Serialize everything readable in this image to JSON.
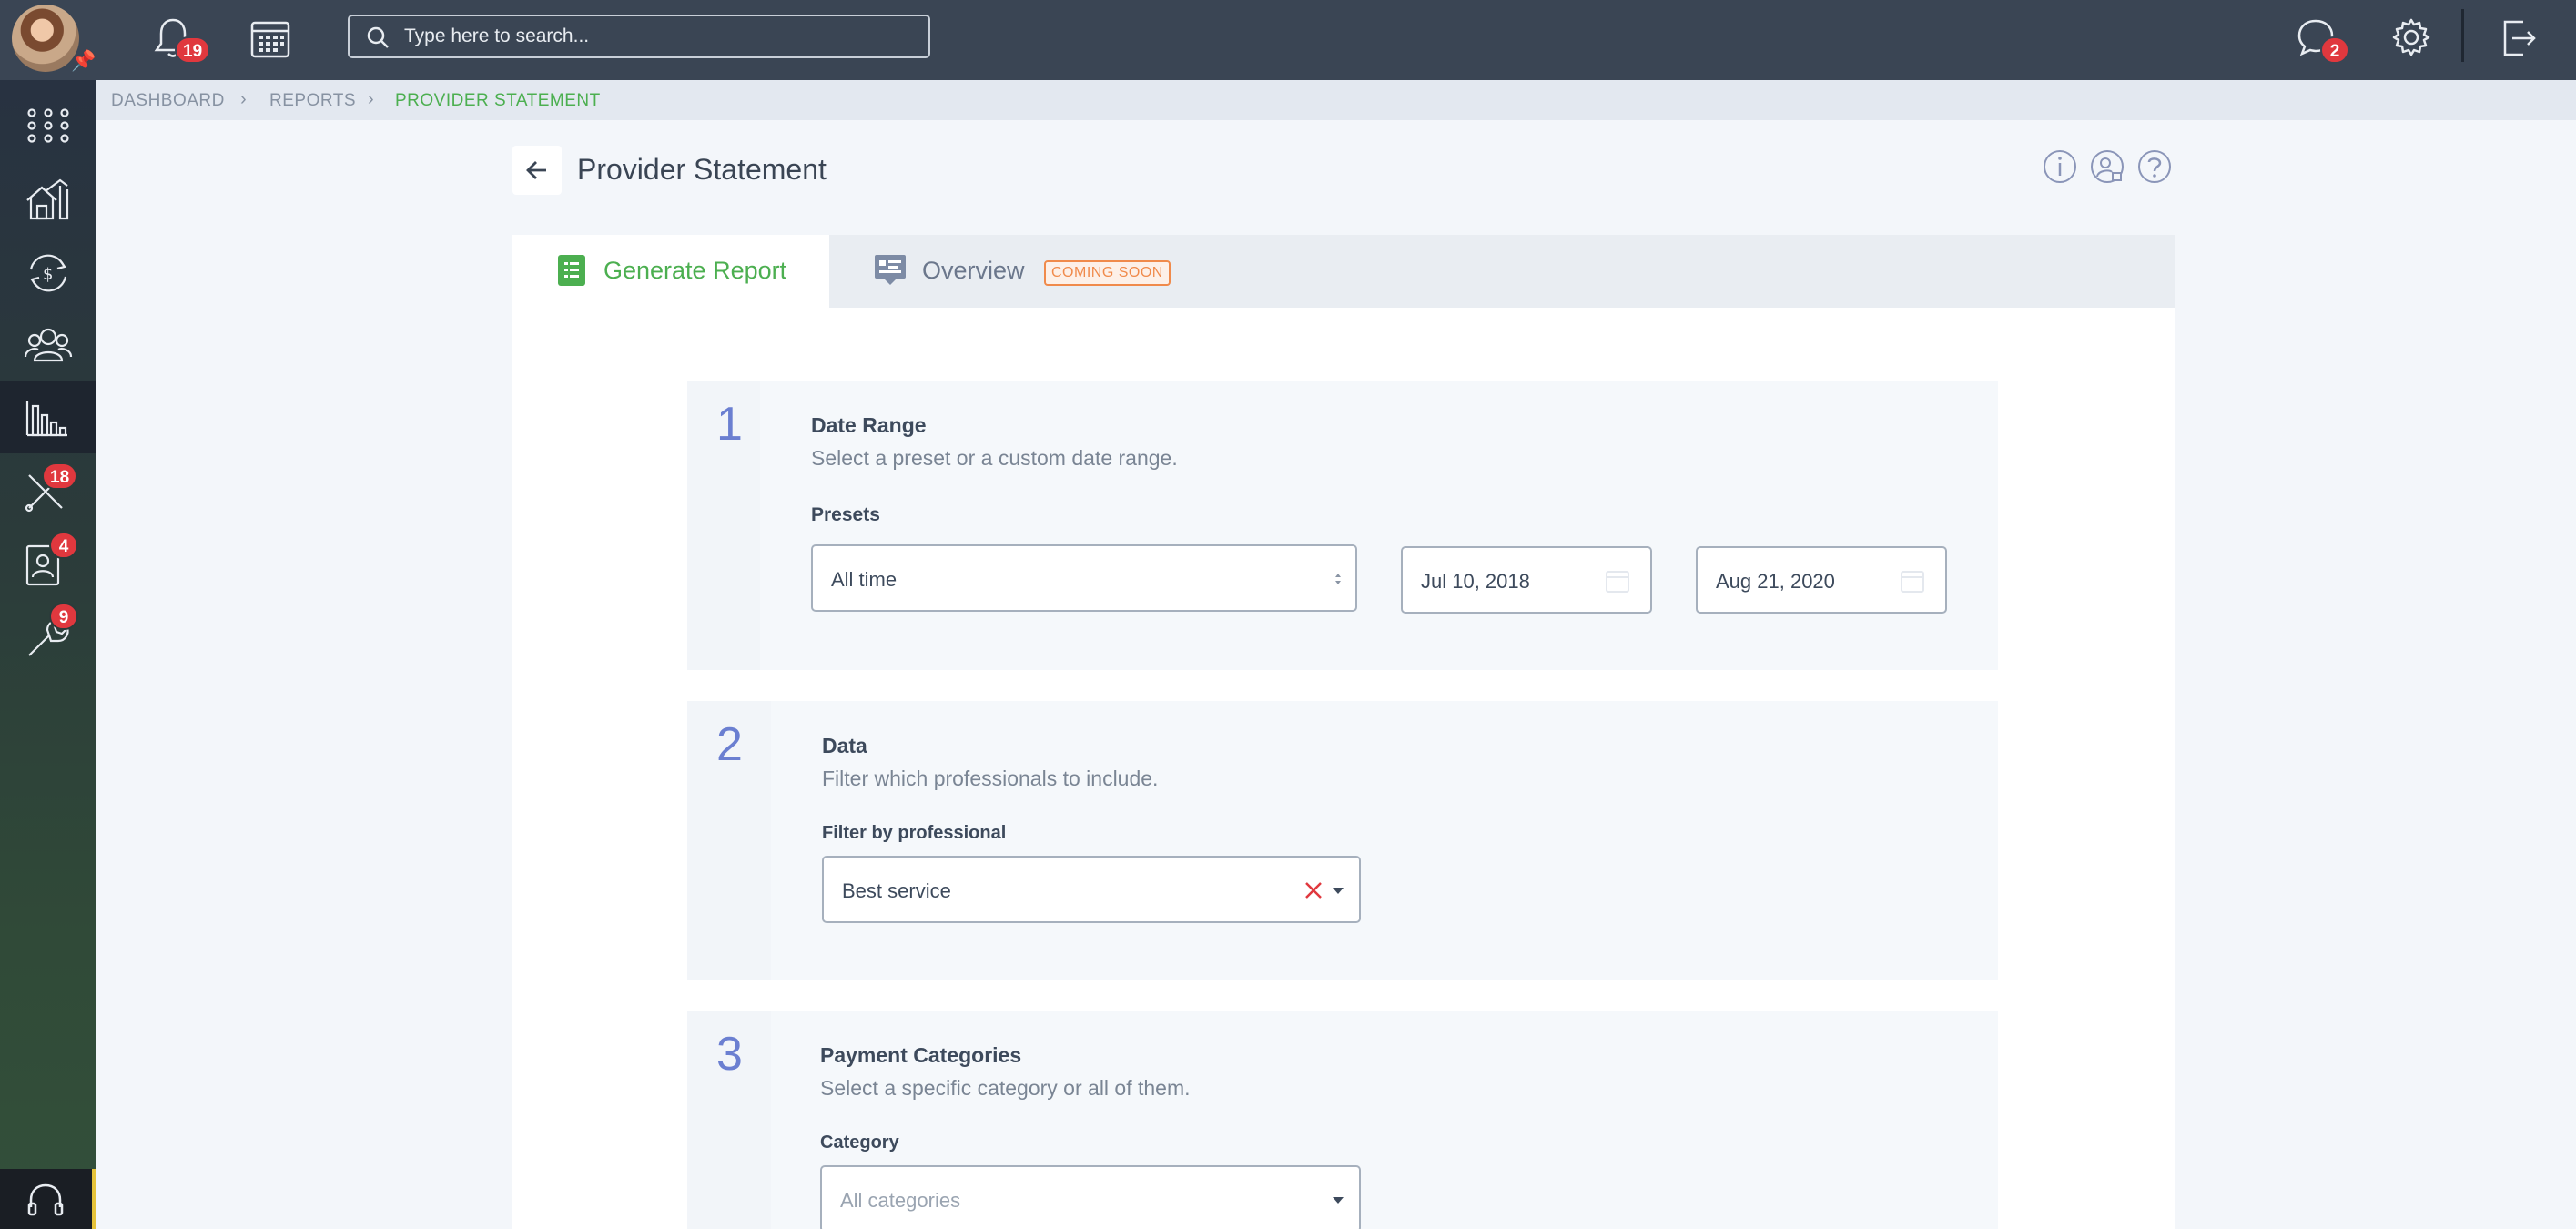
{
  "topbar": {
    "notifications_count": "19",
    "search_placeholder": "Type here to search...",
    "messages_count": "2"
  },
  "sidebar": {
    "items": [
      {
        "icon": "apps-grid-icon"
      },
      {
        "icon": "home-icon"
      },
      {
        "icon": "payments-icon"
      },
      {
        "icon": "people-icon"
      },
      {
        "icon": "reports-icon",
        "active": true
      },
      {
        "icon": "tools-icon",
        "badge": "18"
      },
      {
        "icon": "contacts-icon",
        "badge": "4"
      },
      {
        "icon": "wrench-icon",
        "badge": "9"
      }
    ]
  },
  "breadcrumb": {
    "items": [
      "DASHBOARD",
      "REPORTS",
      "PROVIDER STATEMENT"
    ]
  },
  "page": {
    "title": "Provider Statement"
  },
  "tabs": [
    {
      "label": "Generate Report",
      "active": true
    },
    {
      "label": "Overview",
      "tag": "COMING SOON"
    }
  ],
  "steps": [
    {
      "number": "1",
      "title": "Date Range",
      "description": "Select a preset or a custom date range.",
      "field_label": "Presets",
      "preset_value": "All time",
      "start_date": "Jul 10, 2018",
      "end_date": "Aug 21, 2020"
    },
    {
      "number": "2",
      "title": "Data",
      "description": "Filter which professionals to include.",
      "field_label": "Filter by professional",
      "value": "Best service"
    },
    {
      "number": "3",
      "title": "Payment Categories",
      "description": "Select a specific category or all of them.",
      "field_label": "Category",
      "placeholder": "All categories"
    }
  ],
  "colors": {
    "topbar": "#3a4554",
    "accent_green": "#4caf50",
    "step_number": "#6b7fd1",
    "badge_red": "#e0383e",
    "coming_soon": "#f08a4b"
  }
}
